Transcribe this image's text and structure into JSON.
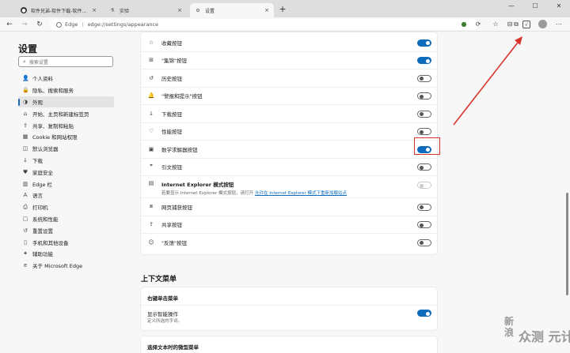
{
  "tabs": [
    {
      "label": "软件兄弟-软件下载-软件下载平台",
      "close": "×"
    },
    {
      "label": "实验",
      "close": "×"
    },
    {
      "label": "设置",
      "close": "×"
    }
  ],
  "new_tab": "+",
  "window_controls": {
    "minimize": "—",
    "maximize": "☐",
    "close": "✕"
  },
  "address": {
    "browser_label": "Edge",
    "url": "edge://settings/appearance"
  },
  "nav_buttons": {
    "back": "←",
    "forward": "→",
    "refresh": "↻"
  },
  "sidebar": {
    "title": "设置",
    "search_placeholder": "搜索设置",
    "items": [
      {
        "label": "个人资料",
        "icon": "👤"
      },
      {
        "label": "隐私、搜索和服务",
        "icon": "🔒"
      },
      {
        "label": "外观",
        "icon": "◑"
      },
      {
        "label": "开始、主页和新建标签页",
        "icon": "⌂"
      },
      {
        "label": "共享、复制和粘贴",
        "icon": "⇪"
      },
      {
        "label": "Cookie 和网站权限",
        "icon": "▦"
      },
      {
        "label": "默认浏览器",
        "icon": "◫"
      },
      {
        "label": "下载",
        "icon": "↓"
      },
      {
        "label": "家庭安全",
        "icon": "♥"
      },
      {
        "label": "Edge 栏",
        "icon": "▥"
      },
      {
        "label": "语言",
        "icon": "A"
      },
      {
        "label": "打印机",
        "icon": "⎙"
      },
      {
        "label": "系统和性能",
        "icon": "▢"
      },
      {
        "label": "重置设置",
        "icon": "↺"
      },
      {
        "label": "手机和其他设备",
        "icon": "▯"
      },
      {
        "label": "辅助功能",
        "icon": "✦"
      },
      {
        "label": "关于 Microsoft Edge",
        "icon": "e"
      }
    ],
    "selected_index": 2
  },
  "toolbar_buttons": [
    {
      "label": "收藏按钮",
      "icon": "☆",
      "on": true
    },
    {
      "label": "\"集锦\"按钮",
      "icon": "⊞",
      "on": true
    },
    {
      "label": "历史按钮",
      "icon": "↺",
      "on": false
    },
    {
      "label": "\"警报和提示\"按钮",
      "icon": "🔔",
      "on": false
    },
    {
      "label": "下载按钮",
      "icon": "↓",
      "on": false
    },
    {
      "label": "性能按钮",
      "icon": "♡",
      "on": false
    },
    {
      "label": "数学求解器按钮",
      "icon": "▣",
      "on": true
    },
    {
      "label": "引文按钮",
      "icon": "❞",
      "on": false
    }
  ],
  "ie_button": {
    "label": "Internet Explorer 模式按钮",
    "desc": "若要显示 Internet Explorer 模式按钮，请打开",
    "link": "允许在 Internet Explorer 模式下重新加载站点",
    "icon": "▤",
    "on": false
  },
  "toolbar_buttons_2": [
    {
      "label": "网页捕获按钮",
      "icon": "⧈",
      "on": false
    },
    {
      "label": "共享按钮",
      "icon": "⇪",
      "on": false
    },
    {
      "label": "\"反馈\"按钮",
      "icon": "☺",
      "on": false
    }
  ],
  "context_menu": {
    "section_title": "上下文菜单",
    "right_click_header": "右键单击菜单",
    "smart_actions_label": "显示智能操作",
    "smart_actions_desc": "定义所选的字词。",
    "smart_actions_on": true,
    "mini_menu_header": "选择文本时的微型菜单"
  },
  "watermark": {
    "line1": "新\n浪",
    "line2": "众测",
    "line3": "元计算"
  },
  "colors": {
    "accent": "#0f6cbd",
    "highlight": "#d8332a"
  }
}
